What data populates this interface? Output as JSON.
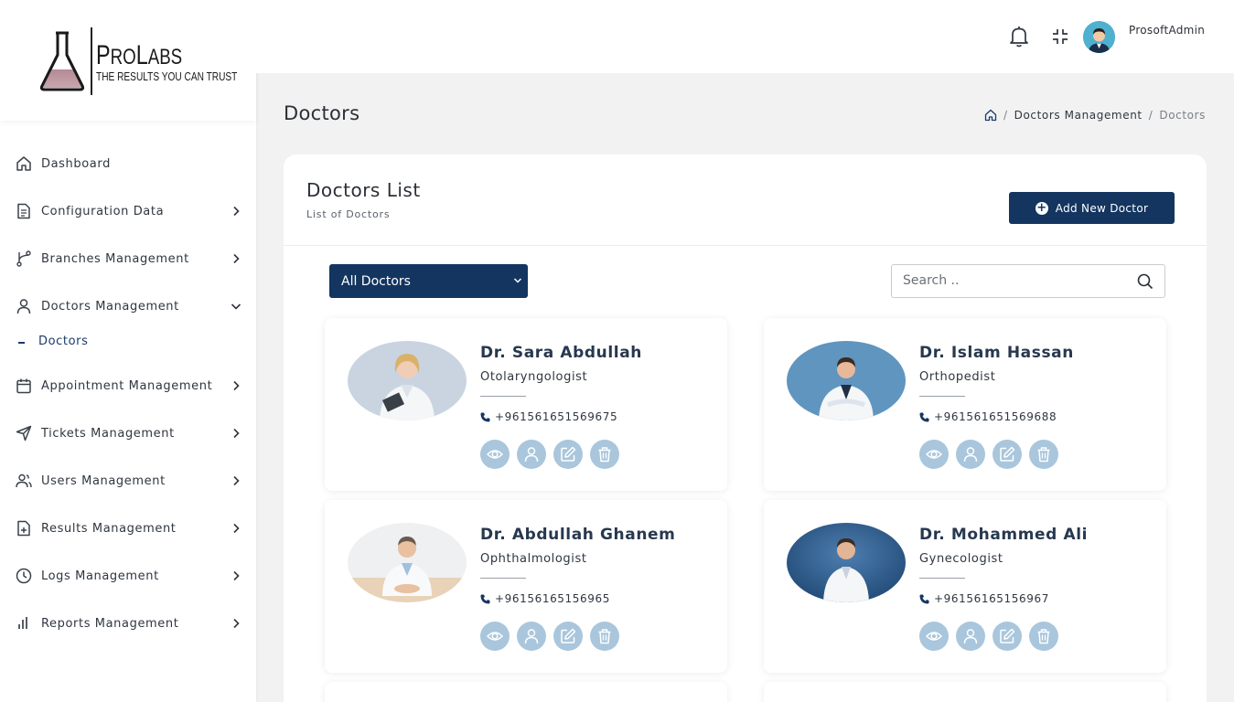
{
  "brand": {
    "name": "ProLabs",
    "tagline": "The results you can trust"
  },
  "sidebar": {
    "items": [
      {
        "label": "Dashboard",
        "icon": "home-icon"
      },
      {
        "label": "Configuration Data",
        "icon": "document-icon"
      },
      {
        "label": "Branches Management",
        "icon": "branch-icon"
      },
      {
        "label": "Doctors Management",
        "icon": "user-icon",
        "expanded": true
      },
      {
        "label": "Appointment Management",
        "icon": "calendar-icon"
      },
      {
        "label": "Tickets Management",
        "icon": "send-icon"
      },
      {
        "label": "Users Management",
        "icon": "users-icon"
      },
      {
        "label": "Results Management",
        "icon": "file-plus-icon"
      },
      {
        "label": "Logs Management",
        "icon": "clock-icon"
      },
      {
        "label": "Reports Management",
        "icon": "bar-chart-icon"
      }
    ],
    "sub_items": [
      {
        "label": "Doctors",
        "active": true
      }
    ]
  },
  "header": {
    "username": "ProsoftAdmin"
  },
  "page": {
    "title": "Doctors",
    "breadcrumb": [
      "Doctors Management",
      "Doctors"
    ]
  },
  "card": {
    "title": "Doctors List",
    "subtitle": "List of Doctors",
    "add_button": "Add New Doctor",
    "filter_value": "All Doctors",
    "search_placeholder": "Search .."
  },
  "doctors": [
    {
      "name": "Dr. Sara Abdullah",
      "specialty": "Otolaryngologist",
      "phone": "+961561651569675"
    },
    {
      "name": "Dr. Islam Hassan",
      "specialty": "Orthopedist",
      "phone": "+961561651569688"
    },
    {
      "name": "Dr. Abdullah Ghanem",
      "specialty": "Ophthalmologist",
      "phone": "+96156165156965"
    },
    {
      "name": "Dr. Mohammed Ali",
      "specialty": "Gynecologist",
      "phone": "+96156165156967"
    }
  ],
  "colors": {
    "primary": "#133560",
    "action_icon_bg": "#a9c6dc",
    "page_bg": "#f2f2f2"
  }
}
